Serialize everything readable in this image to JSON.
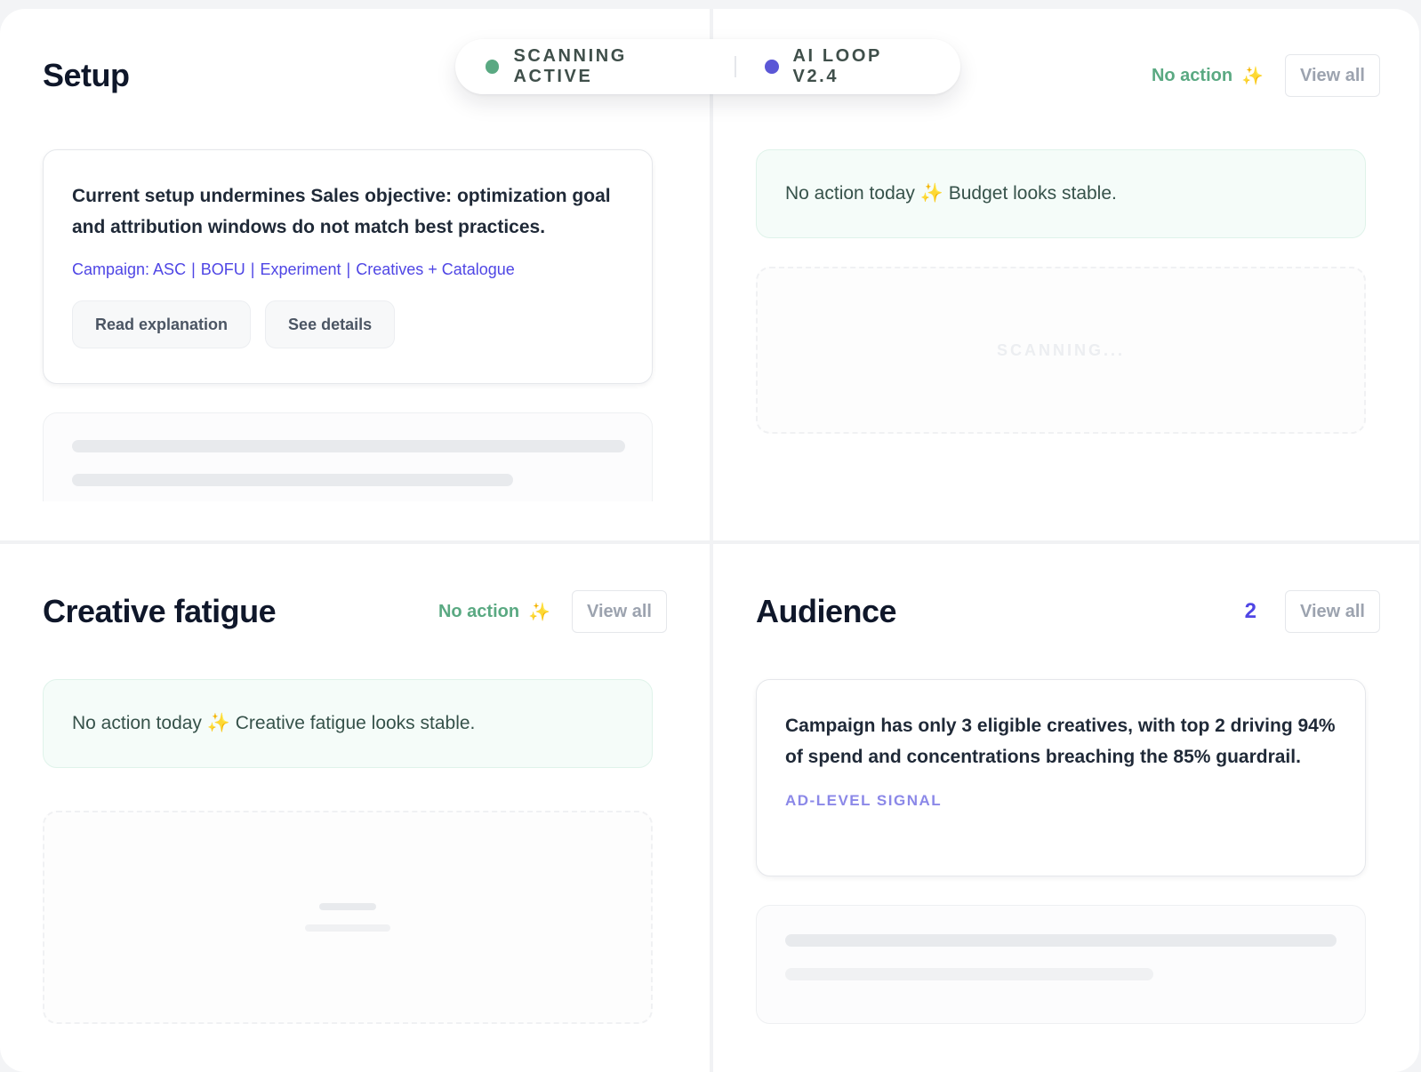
{
  "status": {
    "scanning_label": "SCANNING ACTIVE",
    "scanning_color": "#5aa982",
    "loop_label": "AI LOOP V2.4",
    "loop_color": "#5b57d6"
  },
  "setup": {
    "title": "Setup",
    "card": {
      "text": "Current setup undermines Sales objective: optimization goal and attribution windows do not match best practices.",
      "tags": [
        "Campaign: ASC",
        "BOFU",
        "Experiment",
        "Creatives + Catalogue"
      ],
      "read_label": "Read explanation",
      "details_label": "See details"
    }
  },
  "budget": {
    "no_action_label": "No action",
    "view_all_label": "View all",
    "message": "No action today ✨ Budget looks stable.",
    "scanning_text": "SCANNING..."
  },
  "creative": {
    "title": "Creative fatigue",
    "no_action_label": "No action",
    "view_all_label": "View all",
    "message": "No action today ✨ Creative fatigue looks stable."
  },
  "audience": {
    "title": "Audience",
    "count": "2",
    "view_all_label": "View all",
    "card": {
      "text": "Campaign has only 3 eligible creatives, with top 2 driving 94% of spend and concentrations breaching the 85% guardrail.",
      "signal": "AD-LEVEL SIGNAL"
    }
  },
  "icons": {
    "sparkle": "✨"
  },
  "colors": {
    "accent": "#4f46e5",
    "success": "#5aa982"
  }
}
